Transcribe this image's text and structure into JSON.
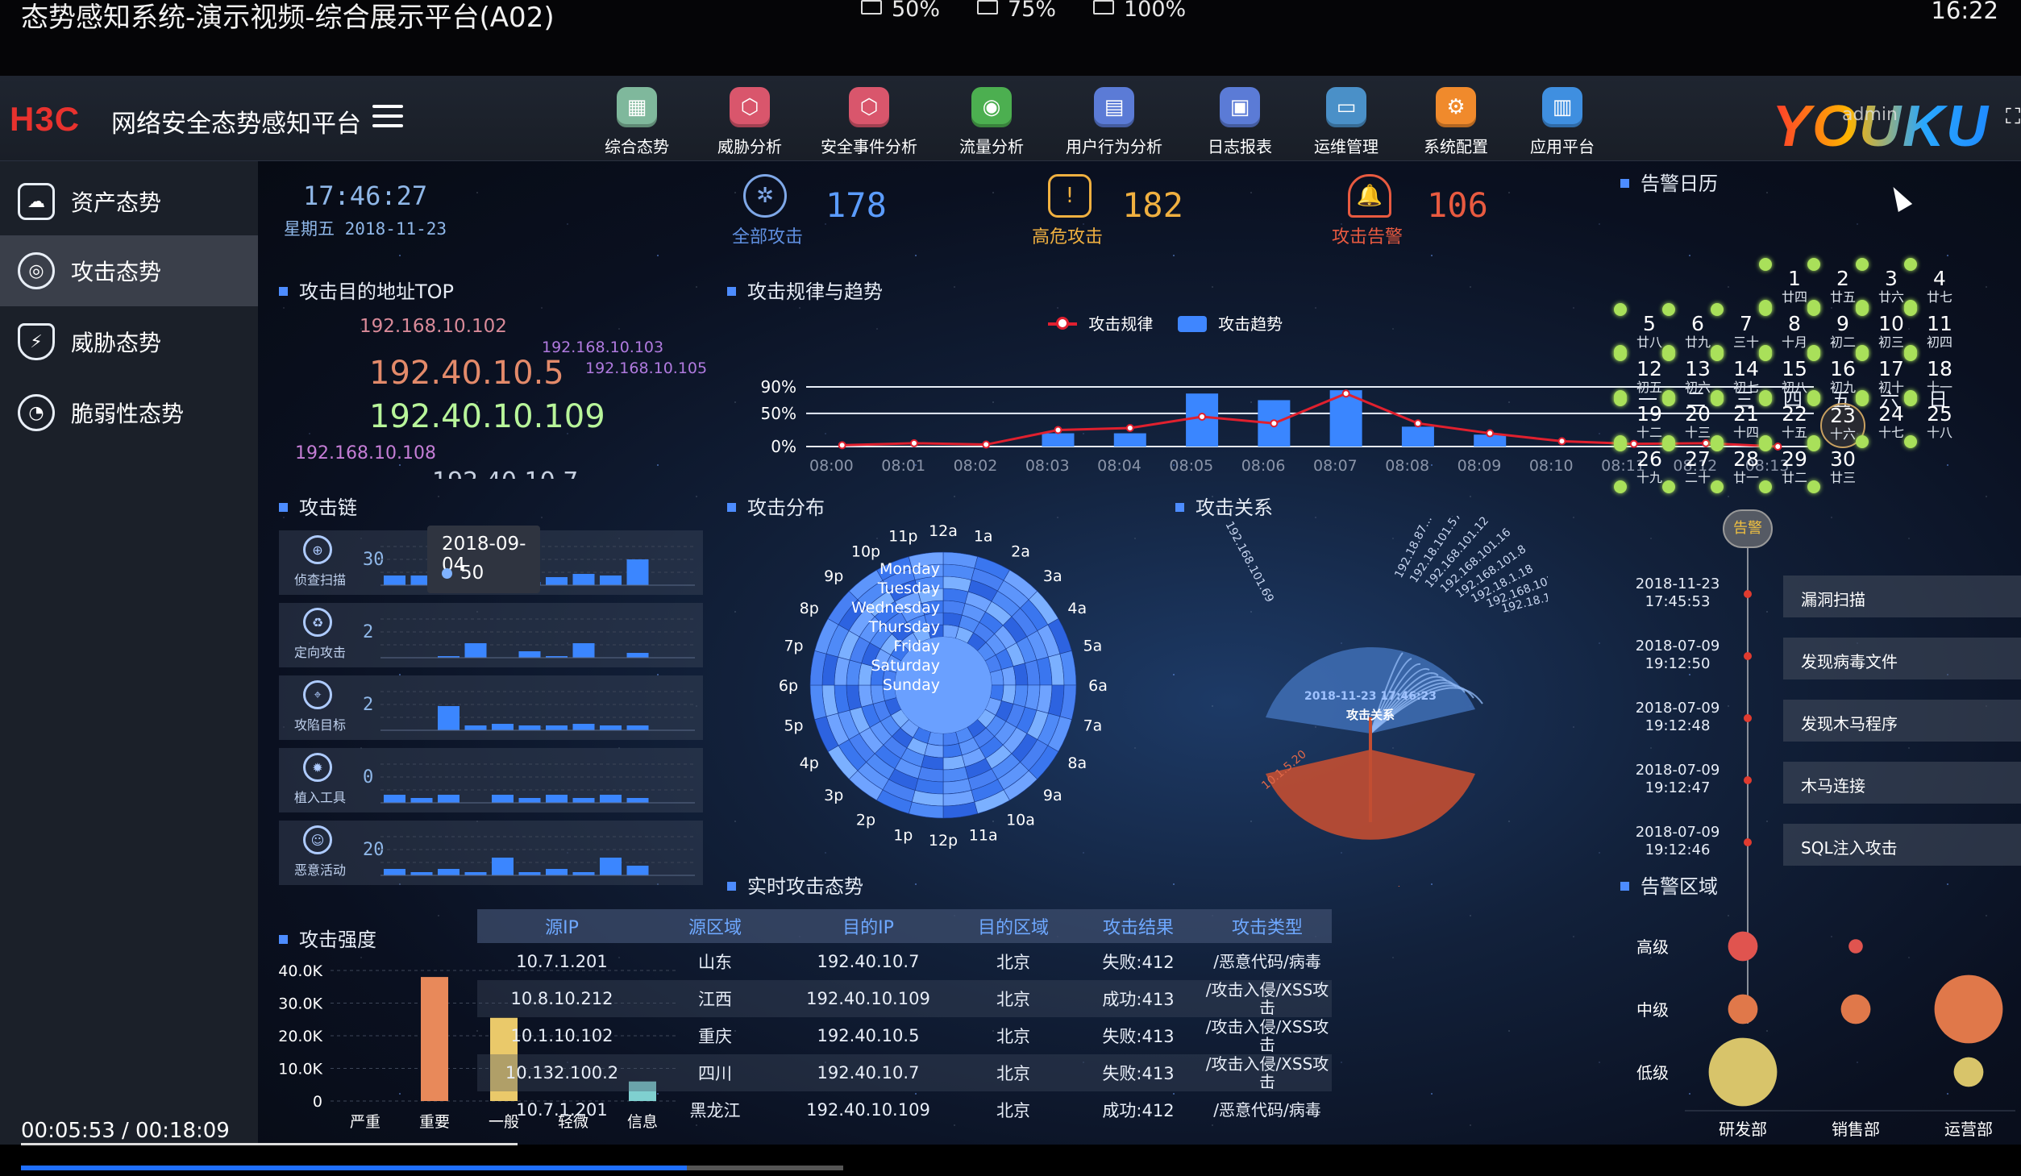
{
  "player": {
    "title": "态势感知系统-演示视频-综合展示平台(A02)",
    "qualities": [
      "50%",
      "75%",
      "100%"
    ],
    "clock": "16:22",
    "time_code": "00:05:53 / 00:18:09",
    "progress": 0.324
  },
  "header": {
    "logo": "H3C",
    "title": "网络安全态势感知平台",
    "nav": [
      {
        "label": "综合态势",
        "icon": "dashboard-icon",
        "color": "#7fb89c"
      },
      {
        "label": "威胁分析",
        "icon": "cube-icon",
        "color": "#d9566c"
      },
      {
        "label": "安全事件分析",
        "icon": "cube-icon",
        "color": "#d9566c"
      },
      {
        "label": "流量分析",
        "icon": "flow-icon",
        "color": "#4caf50"
      },
      {
        "label": "用户行为分析",
        "icon": "chart-icon",
        "color": "#5b7bd6"
      },
      {
        "label": "日志报表",
        "icon": "report-icon",
        "color": "#5b7bd6"
      },
      {
        "label": "运维管理",
        "icon": "monitor-icon",
        "color": "#4a90c8"
      },
      {
        "label": "系统配置",
        "icon": "gear-icon",
        "color": "#f08a2c"
      },
      {
        "label": "应用平台",
        "icon": "briefcase-icon",
        "color": "#3f8fe0"
      }
    ],
    "watermark": "YOUKU",
    "user": "admin"
  },
  "sidebar": {
    "items": [
      {
        "label": "资产态势",
        "icon": "cloud-icon"
      },
      {
        "label": "攻击态势",
        "icon": "target-icon"
      },
      {
        "label": "威胁态势",
        "icon": "shield-icon"
      },
      {
        "label": "脆弱性态势",
        "icon": "gauge-icon"
      }
    ],
    "active_index": 1
  },
  "status": {
    "time": "17:46:27",
    "date": "星期五 2018-11-23",
    "total_label": "全部攻击",
    "total_value": "178",
    "high_label": "高危攻击",
    "high_value": "182",
    "alert_label": "攻击告警",
    "alert_value": "106"
  },
  "attack_target": {
    "title": "攻击目的地址TOP",
    "ips": [
      {
        "ip": "192.168.10.102",
        "color": "#d98a99"
      },
      {
        "ip": "192.168.10.103",
        "color": "#b07adf"
      },
      {
        "ip": "192.168.10.105",
        "color": "#b07adf"
      },
      {
        "ip": "192.40.10.5",
        "color": "#e38a6a"
      },
      {
        "ip": "192.40.10.109",
        "color": "#b8f59a"
      },
      {
        "ip": "192.168.10.108",
        "color": "#c57ed6"
      },
      {
        "ip": "192.40.10.7",
        "color": "#c6d0e0"
      }
    ]
  },
  "trend": {
    "title": "攻击规律与趋势",
    "legend": [
      "攻击规律",
      "攻击趋势"
    ],
    "chart_data": {
      "type": "bar",
      "categories": [
        "08:00",
        "08:01",
        "08:02",
        "08:03",
        "08:04",
        "08:05",
        "08:06",
        "08:07",
        "08:08",
        "08:09",
        "08:10",
        "08:11",
        "08:12",
        "08:13"
      ],
      "series": [
        {
          "name": "攻击趋势",
          "type": "bar",
          "values": [
            0,
            0,
            0,
            20,
            20,
            80,
            70,
            85,
            30,
            18,
            0,
            0,
            0,
            0
          ]
        },
        {
          "name": "攻击规律",
          "type": "line",
          "values": [
            2,
            5,
            3,
            25,
            28,
            45,
            35,
            80,
            35,
            20,
            8,
            4,
            5,
            0
          ]
        }
      ],
      "y_ticks": [
        "0%",
        "50%",
        "90%"
      ],
      "ylim": [
        0,
        90
      ]
    }
  },
  "chain": {
    "title": "攻击链",
    "tooltip": {
      "date": "2018-09-04",
      "value": "50"
    },
    "rows": [
      {
        "label": "侦查扫描",
        "icon": "scan-icon",
        "count": "30",
        "bars": [
          12,
          12,
          10,
          6,
          22,
          4,
          10,
          14,
          12,
          32
        ]
      },
      {
        "label": "定向攻击",
        "icon": "recycle-icon",
        "count": "2",
        "bars": [
          0,
          0,
          2,
          18,
          0,
          8,
          2,
          18,
          0,
          6
        ]
      },
      {
        "label": "攻陷目标",
        "icon": "crosshair-icon",
        "count": "2",
        "bars": [
          0,
          0,
          30,
          6,
          8,
          6,
          6,
          8,
          6,
          6
        ]
      },
      {
        "label": "植入工具",
        "icon": "bug-icon",
        "count": "0",
        "bars": [
          10,
          6,
          10,
          0,
          10,
          6,
          10,
          6,
          10,
          6
        ]
      },
      {
        "label": "恶意活动",
        "icon": "alien-icon",
        "count": "20",
        "bars": [
          8,
          4,
          8,
          4,
          22,
          4,
          8,
          4,
          22,
          12
        ]
      }
    ]
  },
  "intensity": {
    "title": "攻击强度",
    "chart_data": {
      "type": "bar",
      "categories": [
        "严重",
        "重要",
        "一般",
        "轻微",
        "信息"
      ],
      "values": [
        0,
        38000,
        25500,
        0,
        6000
      ],
      "y_ticks": [
        "0",
        "10.0K",
        "20.0K",
        "30.0K",
        "40.0K"
      ],
      "ylim": [
        0,
        40000
      ],
      "colors": [
        "#e85a4f",
        "#e8895a",
        "#eac96a",
        "#8fb3e0",
        "#7fd0d0"
      ]
    }
  },
  "distribution": {
    "title": "攻击分布",
    "hours": [
      "12a",
      "1a",
      "2a",
      "3a",
      "4a",
      "5a",
      "6a",
      "7a",
      "8a",
      "9a",
      "10a",
      "11a",
      "12p",
      "1p",
      "2p",
      "3p",
      "4p",
      "5p",
      "6p",
      "7p",
      "8p",
      "9p",
      "10p",
      "11p"
    ],
    "days": [
      "Monday",
      "Tuesday",
      "Wednesday",
      "Thursday",
      "Friday",
      "Saturday",
      "Sunday"
    ]
  },
  "relation": {
    "title": "攻击关系",
    "center_time": "2018-11-23 17:46:23",
    "center_label": "攻击关系",
    "top_ips": [
      "192.168.101.69",
      "192.18.87...",
      "192.18.101.57",
      "192.168.101.12",
      "192.168.101.16",
      "192.168.101.8",
      "192.18.1.18",
      "192.168.101.13",
      "192.18.10.245"
    ],
    "bottom_ips": [
      "10.1.5.20",
      "10.1.5.20"
    ]
  },
  "realtime": {
    "title": "实时攻击态势",
    "columns": [
      "源IP",
      "源区域",
      "目的IP",
      "目的区域",
      "攻击结果",
      "攻击类型"
    ],
    "rows": [
      [
        "10.7.1.201",
        "山东",
        "192.40.10.7",
        "北京",
        "失败:412",
        "/恶意代码/病毒"
      ],
      [
        "10.8.10.212",
        "江西",
        "192.40.10.109",
        "北京",
        "成功:413",
        "/攻击入侵/XSS攻击"
      ],
      [
        "10.1.10.102",
        "重庆",
        "192.40.10.5",
        "北京",
        "失败:413",
        "/攻击入侵/XSS攻击"
      ],
      [
        "10.132.100.2",
        "四川",
        "192.40.10.7",
        "北京",
        "失败:413",
        "/攻击入侵/XSS攻击"
      ],
      [
        "10.7.1.201",
        "黑龙江",
        "192.40.10.109",
        "北京",
        "成功:412",
        "/恶意代码/病毒"
      ]
    ]
  },
  "calendar": {
    "title": "告警日历",
    "weekdays": [
      "一",
      "二",
      "三",
      "四",
      "五",
      "六",
      "日"
    ],
    "days": [
      {
        "d": "1",
        "l": "廿四",
        "c": 3
      },
      {
        "d": "2",
        "l": "廿五",
        "c": 4
      },
      {
        "d": "3",
        "l": "廿六",
        "c": 5
      },
      {
        "d": "4",
        "l": "廿七",
        "c": 6
      },
      {
        "d": "5",
        "l": "廿八",
        "c": 0
      },
      {
        "d": "6",
        "l": "廿九",
        "c": 1
      },
      {
        "d": "7",
        "l": "三十",
        "c": 2
      },
      {
        "d": "8",
        "l": "十月",
        "c": 3
      },
      {
        "d": "9",
        "l": "初二",
        "c": 4
      },
      {
        "d": "10",
        "l": "初三",
        "c": 5
      },
      {
        "d": "11",
        "l": "初四",
        "c": 6
      },
      {
        "d": "12",
        "l": "初五",
        "c": 0
      },
      {
        "d": "13",
        "l": "初六",
        "c": 1
      },
      {
        "d": "14",
        "l": "初七",
        "c": 2
      },
      {
        "d": "15",
        "l": "初八",
        "c": 3
      },
      {
        "d": "16",
        "l": "初九",
        "c": 4
      },
      {
        "d": "17",
        "l": "初十",
        "c": 5
      },
      {
        "d": "18",
        "l": "十一",
        "c": 6
      },
      {
        "d": "19",
        "l": "十二",
        "c": 0
      },
      {
        "d": "20",
        "l": "十三",
        "c": 1
      },
      {
        "d": "21",
        "l": "十四",
        "c": 2
      },
      {
        "d": "22",
        "l": "十五",
        "c": 3
      },
      {
        "d": "23",
        "l": "十六",
        "c": 4
      },
      {
        "d": "24",
        "l": "十七",
        "c": 5
      },
      {
        "d": "25",
        "l": "十八",
        "c": 6
      },
      {
        "d": "26",
        "l": "十九",
        "c": 0
      },
      {
        "d": "27",
        "l": "二十",
        "c": 1
      },
      {
        "d": "28",
        "l": "廿一",
        "c": 2
      },
      {
        "d": "29",
        "l": "廿二",
        "c": 3
      },
      {
        "d": "30",
        "l": "廿三",
        "c": 4
      }
    ],
    "today": "23"
  },
  "timeline": {
    "badge": "告警",
    "items": [
      {
        "time": "2018-11-23\n17:45:53",
        "event": "漏洞扫描"
      },
      {
        "time": "2018-07-09\n19:12:50",
        "event": "发现病毒文件"
      },
      {
        "time": "2018-07-09\n19:12:48",
        "event": "发现木马程序"
      },
      {
        "time": "2018-07-09\n19:12:47",
        "event": "木马连接"
      },
      {
        "time": "2018-07-09\n19:12:46",
        "event": "SQL注入攻击"
      }
    ]
  },
  "alert_area": {
    "title": "告警区域",
    "levels": [
      "高级",
      "中级",
      "低级"
    ],
    "departments": [
      "研发部",
      "销售部",
      "运营部"
    ],
    "chart_data": {
      "type": "scatter",
      "x_categories": [
        "研发部",
        "销售部",
        "运营部"
      ],
      "y_categories": [
        "低级",
        "中级",
        "高级"
      ],
      "points": [
        {
          "x": "研发部",
          "y": "高级",
          "size": 3,
          "color": "#e0544f"
        },
        {
          "x": "销售部",
          "y": "高级",
          "size": 1,
          "color": "#e0544f"
        },
        {
          "x": "研发部",
          "y": "中级",
          "size": 3,
          "color": "#e0784a"
        },
        {
          "x": "销售部",
          "y": "中级",
          "size": 3,
          "color": "#e0784a"
        },
        {
          "x": "运营部",
          "y": "中级",
          "size": 8,
          "color": "#e0784a"
        },
        {
          "x": "研发部",
          "y": "低级",
          "size": 8,
          "color": "#d8c46a"
        },
        {
          "x": "运营部",
          "y": "低级",
          "size": 3,
          "color": "#d8c46a"
        }
      ]
    }
  }
}
